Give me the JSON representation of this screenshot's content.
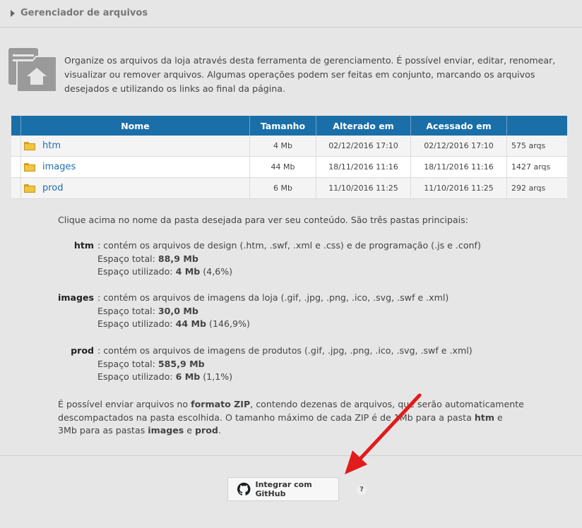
{
  "header": {
    "title": "Gerenciador de arquivos"
  },
  "intro": "Organize os arquivos da loja através desta ferramenta de gerenciamento. É possível enviar, editar, renomear, visualizar ou remover arquivos. Algumas operações podem ser feitas em conjunto, marcando os arquivos desejados e utilizando os links ao final da página.",
  "table": {
    "headers": {
      "name": "Nome",
      "size": "Tamanho",
      "altered": "Alterado em",
      "accessed": "Acessado em"
    },
    "rows": [
      {
        "name": "htm",
        "size": "4 Mb",
        "altered": "02/12/2016 17:10",
        "accessed": "02/12/2016 17:10",
        "count": "575 arqs"
      },
      {
        "name": "images",
        "size": "44 Mb",
        "altered": "18/11/2016 11:16",
        "accessed": "18/11/2016 11:16",
        "count": "1427 arqs"
      },
      {
        "name": "prod",
        "size": "6 Mb",
        "altered": "11/10/2016 11:25",
        "accessed": "11/10/2016 11:25",
        "count": "292 arqs"
      }
    ]
  },
  "description": {
    "lead": "Clique acima no nome da pasta desejada para ver seu conteúdo. São três pastas principais:",
    "folders": [
      {
        "label": "htm",
        "text": ": contém os arquivos de design (.htm, .swf, .xml e .css) e de programação (.js e .conf)",
        "total_label": "Espaço total: ",
        "total": "88,9 Mb",
        "used_label": "Espaço utilizado: ",
        "used": "4 Mb",
        "used_pct": " (4,6%)"
      },
      {
        "label": "images",
        "text": ": contém os arquivos de imagens da loja (.gif, .jpg, .png, .ico, .svg, .swf e .xml)",
        "total_label": "Espaço total: ",
        "total": "30,0 Mb",
        "used_label": "Espaço utilizado: ",
        "used": "44 Mb",
        "used_pct": " (146,9%)"
      },
      {
        "label": "prod",
        "text": ": contém os arquivos de imagens de produtos (.gif, .jpg, .png, .ico, .svg, .swf e .xml)",
        "total_label": "Espaço total: ",
        "total": "585,9 Mb",
        "used_label": "Espaço utilizado: ",
        "used": "6 Mb",
        "used_pct": " (1,1%)"
      }
    ],
    "zip": {
      "p1": "É possível enviar arquivos no ",
      "b1": "formato ZIP",
      "p2": ", contendo dezenas de arquivos, que serão automaticamente descompactados na pasta escolhida. O tamanho máximo de cada ZIP é de 1Mb para a pasta ",
      "b2": "htm",
      "p3": " e 3Mb para as pastas ",
      "b3": "images",
      "p4": " e ",
      "b4": "prod",
      "p5": "."
    }
  },
  "github_button": {
    "label": "Integrar com GitHub",
    "icon": "github-icon"
  },
  "help": "?",
  "colors": {
    "table_header": "#1a6fa8",
    "link": "#1f6fae",
    "arrow": "#e21b1b"
  }
}
